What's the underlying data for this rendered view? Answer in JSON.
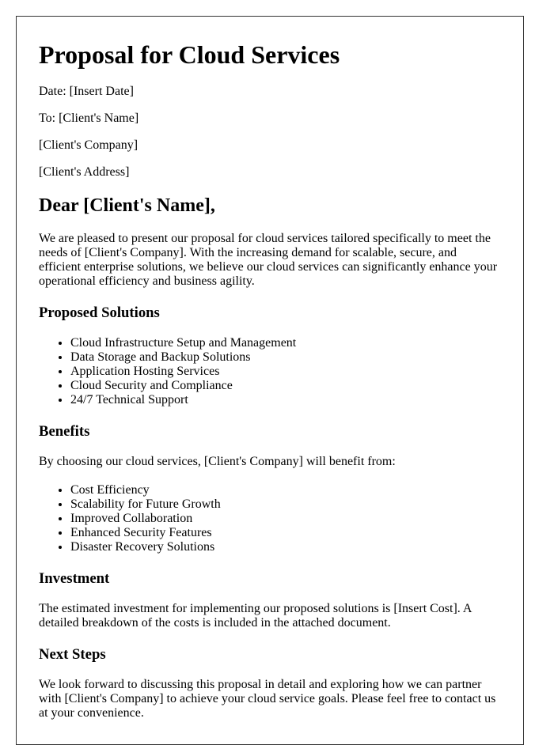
{
  "document": {
    "title": "Proposal for Cloud Services",
    "meta": {
      "date": "Date: [Insert Date]",
      "to": "To: [Client's Name]",
      "company": "[Client's Company]",
      "address": "[Client's Address]"
    },
    "salutation": "Dear [Client's Name],",
    "intro": "We are pleased to present our proposal for cloud services tailored specifically to meet the needs of [Client's Company]. With the increasing demand for scalable, secure, and efficient enterprise solutions, we believe our cloud services can significantly enhance your operational efficiency and business agility.",
    "sections": {
      "solutions": {
        "heading": "Proposed Solutions",
        "items": [
          "Cloud Infrastructure Setup and Management",
          "Data Storage and Backup Solutions",
          "Application Hosting Services",
          "Cloud Security and Compliance",
          "24/7 Technical Support"
        ]
      },
      "benefits": {
        "heading": "Benefits",
        "intro": "By choosing our cloud services, [Client's Company] will benefit from:",
        "items": [
          "Cost Efficiency",
          "Scalability for Future Growth",
          "Improved Collaboration",
          "Enhanced Security Features",
          "Disaster Recovery Solutions"
        ]
      },
      "investment": {
        "heading": "Investment",
        "text": "The estimated investment for implementing our proposed solutions is [Insert Cost]. A detailed breakdown of the costs is included in the attached document."
      },
      "next_steps": {
        "heading": "Next Steps",
        "text": "We look forward to discussing this proposal in detail and exploring how we can partner with [Client's Company] to achieve your cloud service goals. Please feel free to contact us at your convenience."
      }
    }
  }
}
